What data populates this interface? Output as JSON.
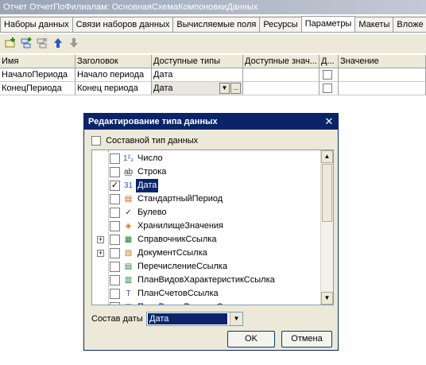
{
  "window": {
    "title": "Отчет ОтчетПоФилиалам: ОсновнаяСхемаКомпоновкиДанных"
  },
  "tabs": [
    {
      "label": "Наборы данных"
    },
    {
      "label": "Связи наборов данных"
    },
    {
      "label": "Вычисляемые поля"
    },
    {
      "label": "Ресурсы"
    },
    {
      "label": "Параметры"
    },
    {
      "label": "Макеты"
    },
    {
      "label": "Вложе"
    }
  ],
  "active_tab": "Параметры",
  "toolbar": {
    "icons": [
      "add-icon",
      "add-subitem-icon",
      "delete-icon",
      "move-up-icon",
      "move-down-icon"
    ]
  },
  "grid": {
    "headers": [
      "Имя",
      "Заголовок",
      "Доступные типы",
      "Доступные знач...",
      "Д...",
      "Значение"
    ],
    "rows": [
      {
        "name": "НачалоПериода",
        "title": "Начало периода",
        "types": "Дата",
        "values": "",
        "value": ""
      },
      {
        "name": "КонецПериода",
        "title": "Конец периода",
        "types": "Дата",
        "values": "",
        "value": ""
      }
    ],
    "ellipsis": "..."
  },
  "dialog": {
    "title": "Редактирование типа данных",
    "composite_label": "Составной тип данных",
    "types": [
      {
        "label": "Число",
        "icon": "number-icon",
        "checked": false,
        "expandable": false
      },
      {
        "label": "Строка",
        "icon": "string-icon",
        "checked": false,
        "expandable": false
      },
      {
        "label": "Дата",
        "icon": "calendar-icon",
        "checked": true,
        "expandable": false
      },
      {
        "label": "СтандартныйПериод",
        "icon": "period-icon",
        "checked": false,
        "expandable": false
      },
      {
        "label": "Булево",
        "icon": "boolean-icon",
        "checked": false,
        "expandable": false
      },
      {
        "label": "ХранилищеЗначения",
        "icon": "storage-icon",
        "checked": false,
        "expandable": false
      },
      {
        "label": "СправочникСсылка",
        "icon": "catalog-icon",
        "checked": false,
        "expandable": true
      },
      {
        "label": "ДокументСсылка",
        "icon": "document-icon",
        "checked": false,
        "expandable": true
      },
      {
        "label": "ПеречислениеСсылка",
        "icon": "enum-icon",
        "checked": false,
        "expandable": false
      },
      {
        "label": "ПланВидовХарактеристикСсылка",
        "icon": "chart-of-characteristics-icon",
        "checked": false,
        "expandable": false
      },
      {
        "label": "ПланСчетовСсылка",
        "icon": "chart-of-accounts-icon",
        "checked": false,
        "expandable": false
      },
      {
        "label": "ПланВидовРасчетаСсылка",
        "icon": "calc-types-icon",
        "checked": false,
        "expandable": false
      }
    ],
    "selected_type": "Дата",
    "date_label": "Состав даты",
    "date_value": "Дата",
    "ok_label": "OK",
    "cancel_label": "Отмена"
  },
  "colors": {
    "selection": "#0a246a",
    "chrome": "#ece9d8",
    "title_gradient_start": "#9aa5b7"
  }
}
